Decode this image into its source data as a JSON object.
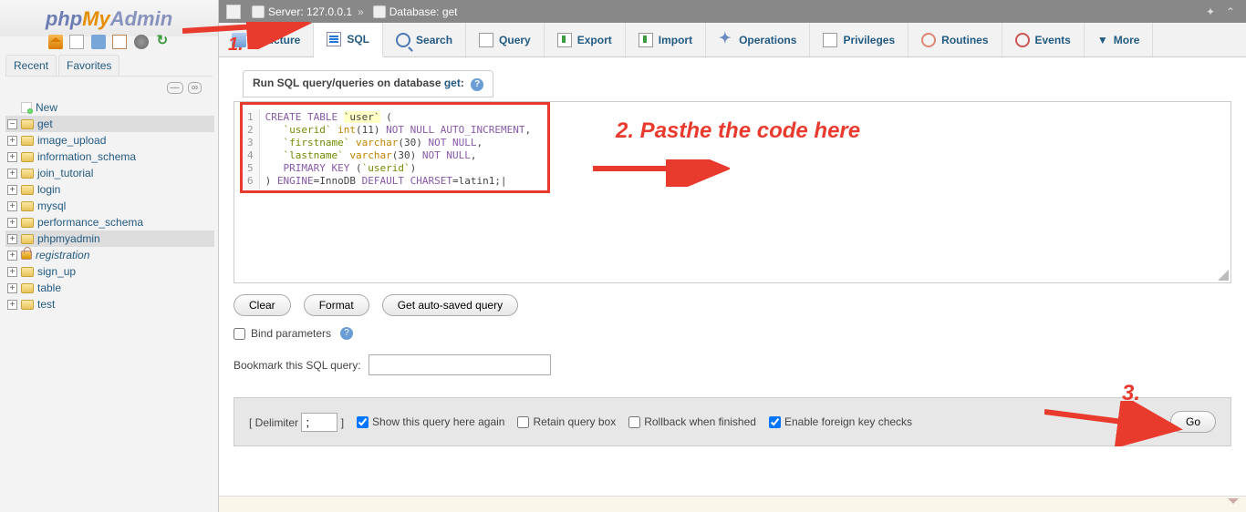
{
  "logo": {
    "php": "php",
    "my": "My",
    "admin": "Admin"
  },
  "sidebar": {
    "recent": "Recent",
    "favorites": "Favorites",
    "new_label": "New",
    "items": [
      {
        "label": "get",
        "selected": true
      },
      {
        "label": "image_upload"
      },
      {
        "label": "information_schema"
      },
      {
        "label": "join_tutorial"
      },
      {
        "label": "login"
      },
      {
        "label": "mysql"
      },
      {
        "label": "performance_schema"
      },
      {
        "label": "phpmyadmin",
        "selected": true
      },
      {
        "label": "registration",
        "italic": true,
        "lock": true
      },
      {
        "label": "sign_up"
      },
      {
        "label": "table"
      },
      {
        "label": "test"
      }
    ]
  },
  "breadcrumb": {
    "server_label": "Server:",
    "server_value": "127.0.0.1",
    "db_label": "Database:",
    "db_value": "get"
  },
  "tabs": [
    {
      "label": "Structure",
      "icon": "ti-struct"
    },
    {
      "label": "SQL",
      "icon": "ti-sql",
      "active": true
    },
    {
      "label": "Search",
      "icon": "ti-search"
    },
    {
      "label": "Query",
      "icon": "ti-query"
    },
    {
      "label": "Export",
      "icon": "ti-export"
    },
    {
      "label": "Import",
      "icon": "ti-import"
    },
    {
      "label": "Operations",
      "icon": "ti-ops"
    },
    {
      "label": "Privileges",
      "icon": "ti-priv"
    },
    {
      "label": "Routines",
      "icon": "ti-rout"
    },
    {
      "label": "Events",
      "icon": "ti-event"
    },
    {
      "label": "More",
      "icon": "ti-more"
    }
  ],
  "query_header": {
    "prefix": "Run SQL query/queries on database ",
    "db": "get",
    "suffix": ":"
  },
  "sql": {
    "lines": [
      [
        [
          "CREATE",
          "kw"
        ],
        [
          " ",
          ""
        ],
        [
          "TABLE",
          "kw"
        ],
        [
          " ",
          ""
        ],
        [
          "`user`",
          "tbl"
        ],
        [
          " (",
          ""
        ]
      ],
      [
        [
          "   ",
          ""
        ],
        [
          "`userid`",
          "str"
        ],
        [
          " ",
          ""
        ],
        [
          "int",
          "ty"
        ],
        [
          "(",
          ""
        ],
        [
          "11",
          "num"
        ],
        [
          ") ",
          ""
        ],
        [
          "NOT",
          "kw"
        ],
        [
          " ",
          ""
        ],
        [
          "NULL",
          "kw"
        ],
        [
          " ",
          ""
        ],
        [
          "AUTO_INCREMENT",
          "kw"
        ],
        [
          ",",
          ""
        ]
      ],
      [
        [
          "   ",
          ""
        ],
        [
          "`firstname`",
          "str"
        ],
        [
          " ",
          ""
        ],
        [
          "varchar",
          "ty"
        ],
        [
          "(",
          ""
        ],
        [
          "30",
          "num"
        ],
        [
          ") ",
          ""
        ],
        [
          "NOT",
          "kw"
        ],
        [
          " ",
          ""
        ],
        [
          "NULL",
          "kw"
        ],
        [
          ",",
          ""
        ]
      ],
      [
        [
          "   ",
          ""
        ],
        [
          "`lastname`",
          "str"
        ],
        [
          " ",
          ""
        ],
        [
          "varchar",
          "ty"
        ],
        [
          "(",
          ""
        ],
        [
          "30",
          "num"
        ],
        [
          ") ",
          ""
        ],
        [
          "NOT",
          "kw"
        ],
        [
          " ",
          ""
        ],
        [
          "NULL",
          "kw"
        ],
        [
          ",",
          ""
        ]
      ],
      [
        [
          "   ",
          ""
        ],
        [
          "PRIMARY",
          "kw"
        ],
        [
          " ",
          ""
        ],
        [
          "KEY",
          "kw"
        ],
        [
          " (",
          ""
        ],
        [
          "`userid`",
          "str"
        ],
        [
          ")",
          ""
        ]
      ],
      [
        [
          ") ",
          ""
        ],
        [
          "ENGINE",
          "kw"
        ],
        [
          "=InnoDB ",
          ""
        ],
        [
          "DEFAULT",
          "kw"
        ],
        [
          " ",
          ""
        ],
        [
          "CHARSET",
          "kw"
        ],
        [
          "=latin1;|",
          ""
        ]
      ]
    ]
  },
  "buttons": {
    "clear": "Clear",
    "format": "Format",
    "autosaved": "Get auto-saved query",
    "go": "Go"
  },
  "bind_params": "Bind parameters",
  "bookmark_label": "Bookmark this SQL query:",
  "footer": {
    "delimiter_label": "[ Delimiter",
    "delimiter_value": ";",
    "delimiter_close": "]",
    "show_again": "Show this query here again",
    "retain": "Retain query box",
    "rollback": "Rollback when finished",
    "fk": "Enable foreign key checks"
  },
  "annotations": {
    "one": "1.",
    "two": "2. Pasthe the code here",
    "three": "3."
  }
}
